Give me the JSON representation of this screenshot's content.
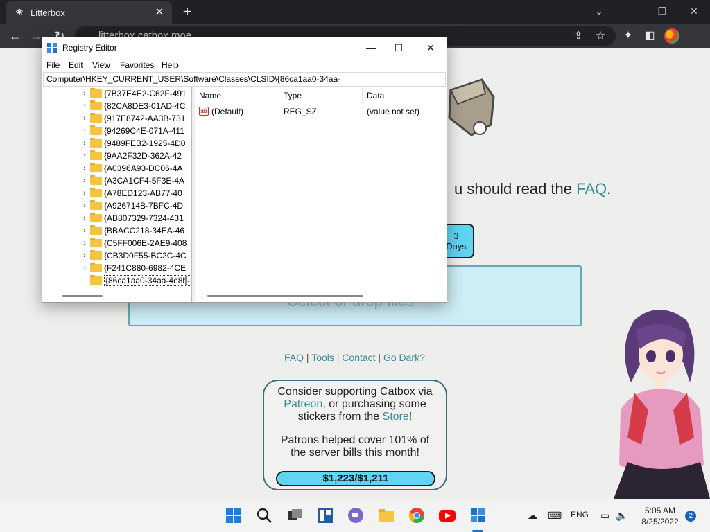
{
  "browser": {
    "tab_title": "Litterbox",
    "tab_close": "✕",
    "new_tab": "+",
    "address": "litterbox.catbox.moe",
    "window_controls": {
      "minimize": "—",
      "restore": "❐",
      "close": "✕",
      "tab_search": "⌄"
    }
  },
  "page": {
    "headline_text": "u should read the ",
    "headline_link": "FAQ",
    "headline_end": ".",
    "duration_value": "3",
    "duration_unit": "Days",
    "drop_text": "Select or drop files",
    "footer": {
      "faq": "FAQ",
      "tools": "Tools",
      "contact": "Contact",
      "dark": "Go Dark?",
      "sep": " | "
    },
    "support": {
      "line1": "Consider supporting Catbox via",
      "patreon": "Patreon",
      "line2_mid": ", or purchasing some",
      "line3_pre": "stickers from the ",
      "store": "Store",
      "line3_end": "!",
      "patrons_text": "Patrons helped cover 101% of the server bills this month!",
      "progress_label": "$1,223/$1,211",
      "progress_fraction": 1.0
    }
  },
  "regedit": {
    "title": "Registry Editor",
    "controls": {
      "minimize": "—",
      "maximize": "☐",
      "close": "✕"
    },
    "menu": [
      "File",
      "Edit",
      "View",
      "Favorites",
      "Help"
    ],
    "address": "Computer\\HKEY_CURRENT_USER\\Software\\Classes\\CLSID\\{86ca1aa0-34aa-",
    "tree": [
      "{7B37E4E2-C62F-491",
      "{82CA8DE3-01AD-4C",
      "{917E8742-AA3B-731",
      "{94269C4E-071A-411",
      "{9489FEB2-1925-4D0",
      "{9AA2F32D-362A-42",
      "{A0396A93-DC06-4A",
      "{A3CA1CF4-5F3E-4A",
      "{A78ED123-AB77-40",
      "{A926714B-7BFC-4D",
      "{AB807329-7324-431",
      "{BBACC218-34EA-46",
      "{C5FF006E-2AE9-408",
      "{CB3D0F55-BC2C-4C",
      "{F241C880-6982-4CE"
    ],
    "selected_key": "{86ca1aa0-34aa-4e8b-",
    "tree_chevron": "›",
    "columns": {
      "name": "Name",
      "type": "Type",
      "data": "Data"
    },
    "values": [
      {
        "icon": "ab",
        "name": "(Default)",
        "type": "REG_SZ",
        "data": "(value not set)"
      }
    ]
  },
  "taskbar": {
    "lang": "ENG",
    "time": "5:05 AM",
    "date": "8/25/2022",
    "notifications": "2"
  },
  "colors": {
    "accent_cyan": "#5fd4f3",
    "link": "#3c8a9a",
    "chrome_dark": "#202124"
  }
}
